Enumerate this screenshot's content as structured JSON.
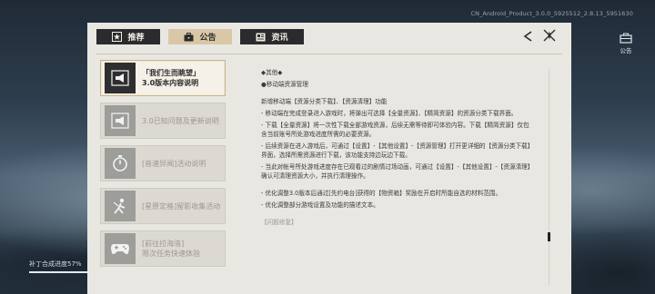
{
  "build_info": "CN_Android_Product_3.0.0_5925512_2.8.13_5951630",
  "side_notice": {
    "label": "公告",
    "icon": "notice-icon"
  },
  "progress": {
    "label": "补丁合成进度57%",
    "value": 0.57
  },
  "tabs": [
    {
      "label": "推荐",
      "icon": "star-card-icon",
      "active": false
    },
    {
      "label": "公告",
      "icon": "briefcase-icon",
      "active": true
    },
    {
      "label": "资讯",
      "icon": "news-icon",
      "active": false
    }
  ],
  "list": [
    {
      "line1": "「我们生而眺望」",
      "line2": "3.0版本内容说明",
      "icon": "megaphone-icon",
      "active": true
    },
    {
      "line1": "3.0已知问题及更新说明",
      "line2": "",
      "icon": "megaphone-icon",
      "active": false
    },
    {
      "line1": "[音速异闻]活动说明",
      "line2": "",
      "icon": "stopwatch-icon",
      "active": false
    },
    {
      "line1": "[星原定格]留影收集活动",
      "line2": "",
      "icon": "figure-icon",
      "active": false
    },
    {
      "line1": "[前往拉海洛]",
      "line2": "限次任务快速体验",
      "icon": "gamepad-icon",
      "active": false
    }
  ],
  "content": {
    "heading": "◆其他◆",
    "subheading": "●移动端资源管理",
    "p1": "新增移动端【资源分类下载】、【资源清理】功能",
    "p2": "- 移动端在完成登录进入游戏时，将弹出可选择【全量资源】、【精简资源】的资源分类下载界面。",
    "p3": "- 下载【全量资源】将一次性下载全部游戏资源，后续无需等待即可体验内容。下载【精简资源】仅包含当前账号所处游戏进度所需的必要资源。",
    "p4": "- 后续资源在进入游戏后，可通过【设置】-【其他设置】-【资源管理】打开更详细的【资源分类下载】界面，选择所需资源进行下载，该功能支持边玩边下载。",
    "p5": "- 当此对帐号所处游戏进度存在已观看过的剧情过场动画，可通过【设置】-【其他设置】-【资源清理】确认可清理资源大小，并执行清理操作。",
    "p6": "- 优化调整3.0版本后通过[先约电台]获得的【物资箱】奖励在开启时所能自选的材料范围。",
    "p7": "- 优化调整部分游戏设置及功能的描述文本。",
    "p8": "【问题修复】"
  }
}
